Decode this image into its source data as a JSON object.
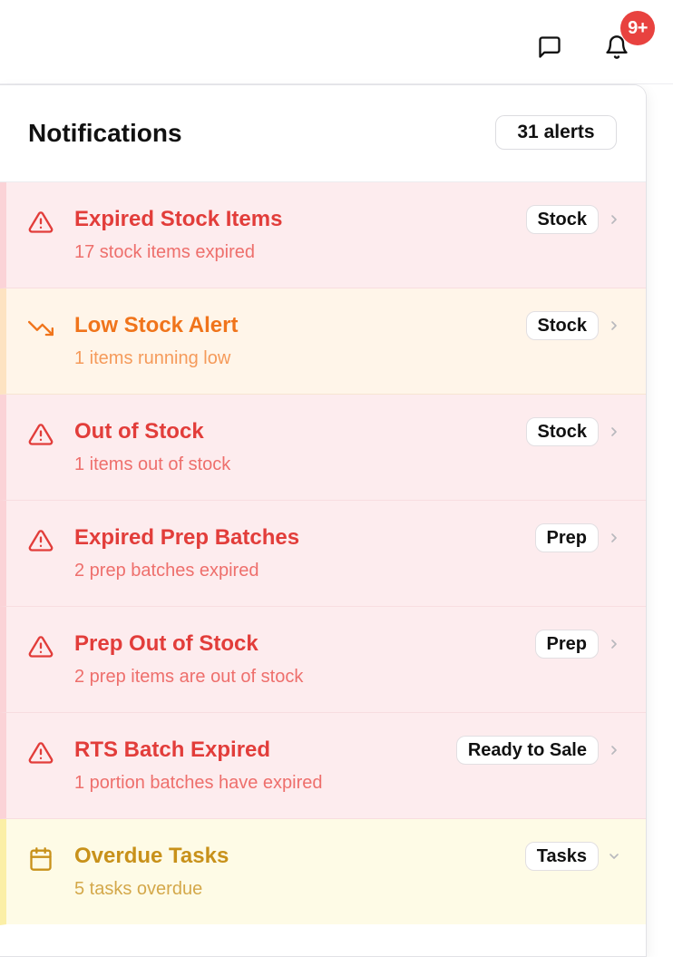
{
  "topbar": {
    "chat_icon": "message-square-icon",
    "bell_icon": "bell-icon",
    "badge_text": "9+",
    "badge_color": "#e8423f"
  },
  "panel": {
    "title": "Notifications",
    "count_label": "31 alerts"
  },
  "colors": {
    "red_title": "#e23d3a",
    "orange_title": "#f0741b",
    "yellow_title": "#c8911a"
  },
  "notifications": [
    {
      "title": "Expired Stock Items",
      "subtitle": "17 stock items expired",
      "tag": "Stock",
      "tone": "red",
      "icon": "alert-triangle-icon",
      "expander": "chevron-right-icon"
    },
    {
      "title": "Low Stock Alert",
      "subtitle": "1 items running low",
      "tag": "Stock",
      "tone": "orange",
      "icon": "trending-down-icon",
      "expander": "chevron-right-icon"
    },
    {
      "title": "Out of Stock",
      "subtitle": "1 items out of stock",
      "tag": "Stock",
      "tone": "red",
      "icon": "alert-triangle-icon",
      "expander": "chevron-right-icon"
    },
    {
      "title": "Expired Prep Batches",
      "subtitle": "2 prep batches expired",
      "tag": "Prep",
      "tone": "red",
      "icon": "alert-triangle-icon",
      "expander": "chevron-right-icon"
    },
    {
      "title": "Prep Out of Stock",
      "subtitle": "2 prep items are out of stock",
      "tag": "Prep",
      "tone": "red",
      "icon": "alert-triangle-icon",
      "expander": "chevron-right-icon"
    },
    {
      "title": "RTS Batch Expired",
      "subtitle": "1 portion batches have expired",
      "tag": "Ready to Sale",
      "tone": "red",
      "icon": "alert-triangle-icon",
      "expander": "chevron-right-icon"
    },
    {
      "title": "Overdue Tasks",
      "subtitle": "5 tasks overdue",
      "tag": "Tasks",
      "tone": "yellow",
      "icon": "calendar-icon",
      "expander": "chevron-down-icon"
    }
  ]
}
